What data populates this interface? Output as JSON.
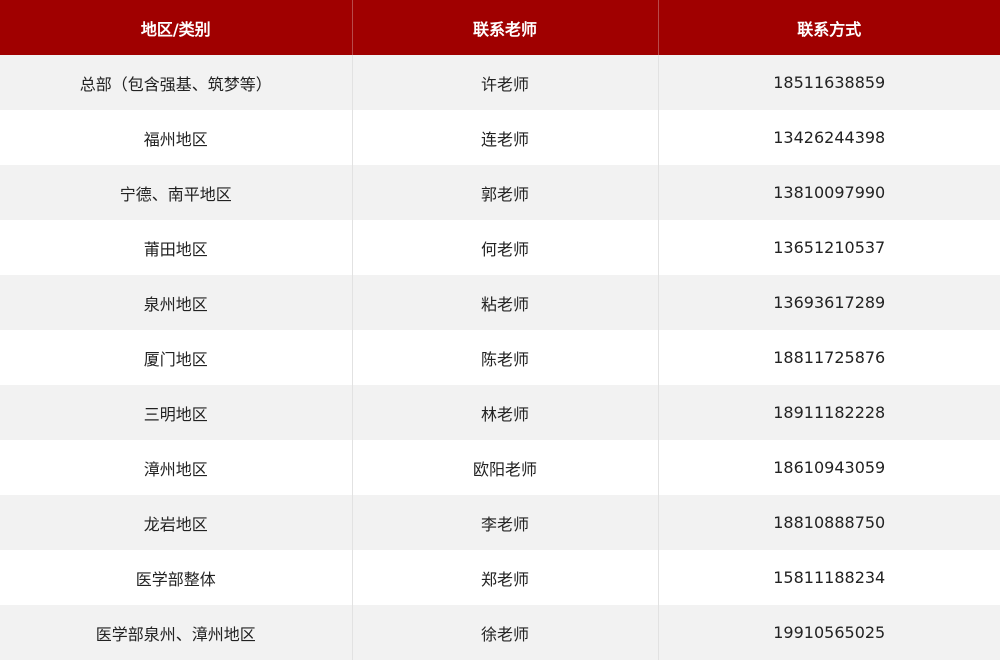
{
  "table": {
    "headers": [
      "地区/类别",
      "联系老师",
      "联系方式"
    ],
    "rows": [
      {
        "region": "总部（包含强基、筑梦等）",
        "teacher": "许老师",
        "phone": "18511638859"
      },
      {
        "region": "福州地区",
        "teacher": "连老师",
        "phone": "13426244398"
      },
      {
        "region": "宁德、南平地区",
        "teacher": "郭老师",
        "phone": "13810097990"
      },
      {
        "region": "莆田地区",
        "teacher": "何老师",
        "phone": "13651210537"
      },
      {
        "region": "泉州地区",
        "teacher": "粘老师",
        "phone": "13693617289"
      },
      {
        "region": "厦门地区",
        "teacher": "陈老师",
        "phone": "18811725876"
      },
      {
        "region": "三明地区",
        "teacher": "林老师",
        "phone": "18911182228"
      },
      {
        "region": "漳州地区",
        "teacher": "欧阳老师",
        "phone": "18610943059"
      },
      {
        "region": "龙岩地区",
        "teacher": "李老师",
        "phone": "18810888750"
      },
      {
        "region": "医学部整体",
        "teacher": "郑老师",
        "phone": "15811188234"
      },
      {
        "region": "医学部泉州、漳州地区",
        "teacher": "徐老师",
        "phone": "19910565025"
      }
    ]
  },
  "colors": {
    "header_bg": "#a00000",
    "header_text": "#ffffff",
    "stripe_bg": "#f2f2f2"
  }
}
